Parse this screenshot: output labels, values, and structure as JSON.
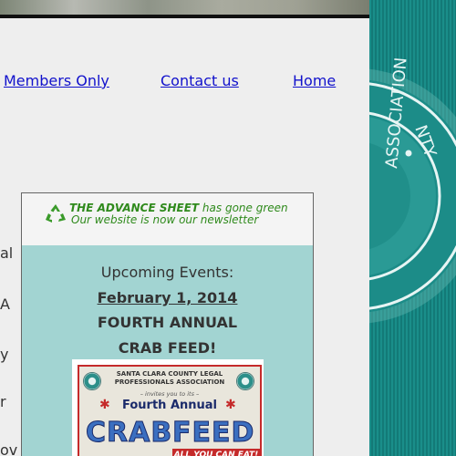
{
  "nav": {
    "members_only": "Members Only",
    "contact_us": "Contact us",
    "home": "Home"
  },
  "left_fragments": [
    "al",
    "A",
    "y",
    "r",
    "ov"
  ],
  "newsletter": {
    "line1_brand": "THE ADVANCE SHEET",
    "line1_rest": " has gone green",
    "line2": "Our website is now our newsletter",
    "icon": "recycle-icon"
  },
  "events": {
    "title": "Upcoming Events:",
    "date": "February 1, 2014",
    "name_line1": "FOURTH ANNUAL",
    "name_line2": "CRAB FEED!"
  },
  "flyer": {
    "org_line1": "SANTA CLARA COUNTY LEGAL",
    "org_line2": "PROFESSIONALS ASSOCIATION",
    "invite": "– invites you to its –",
    "fourth": "Fourth Annual",
    "crab": "CRAB",
    "feed": "FEED",
    "all_you_can_eat": "ALL YOU CAN EAT!"
  },
  "seal_text": {
    "arc_top": "NTY",
    "arc_side": "ASSOCIATION"
  },
  "colors": {
    "link": "#1111cc",
    "teal": "#1a8e8a",
    "events_bg": "#a2d4d2",
    "green_text": "#2f8a1c",
    "flyer_red": "#c52a2a"
  }
}
